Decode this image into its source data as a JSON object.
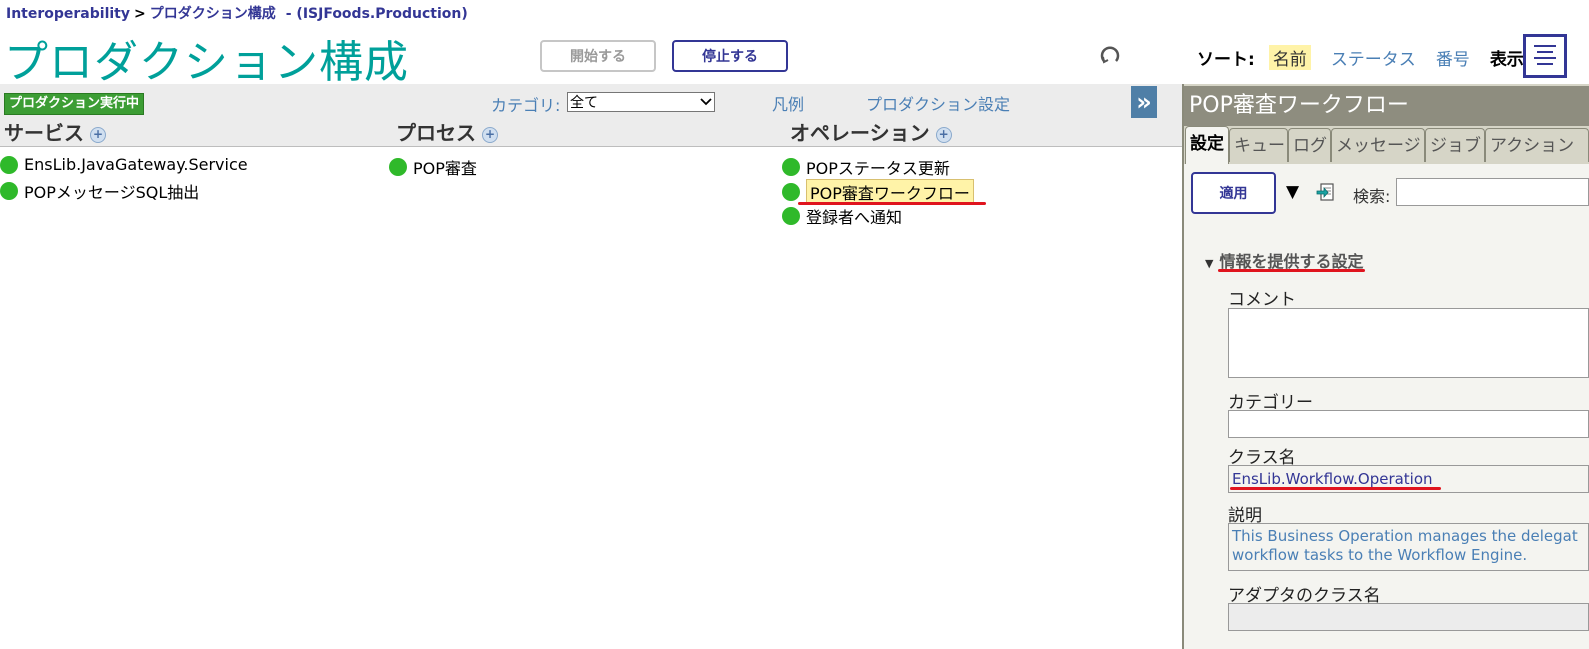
{
  "breadcrumb": {
    "root": "Interoperability",
    "separator": ">",
    "page": "プロダクション構成",
    "namespace": "- (ISJFoods.Production)"
  },
  "header": {
    "title": "プロダクション構成",
    "start_label": "開始する",
    "stop_label": "停止する",
    "sort_label": "ソート:",
    "sort_options": [
      "名前",
      "ステータス",
      "番号"
    ],
    "sort_selected": "名前",
    "view_label": "表示:"
  },
  "toolbar": {
    "status_badge": "プロダクション実行中",
    "category_label": "カテゴリ:",
    "category_value": "全て",
    "legend_link": "凡例",
    "settings_link": "プロダクション設定",
    "collapse_glyph": "»"
  },
  "columns": {
    "services": {
      "title": "サービス",
      "items": [
        "EnsLib.JavaGateway.Service",
        "POPメッセージSQL抽出"
      ]
    },
    "processes": {
      "title": "プロセス",
      "items": [
        "POP審査"
      ]
    },
    "operations": {
      "title": "オペレーション",
      "items": [
        "POPステータス更新",
        "POP審査ワークフロー",
        "登録者へ通知"
      ],
      "selected": "POP審査ワークフロー"
    }
  },
  "status_color": "#2fb92a",
  "panel": {
    "title": "POP審査ワークフロー",
    "tabs": [
      "設定",
      "キュー",
      "ログ",
      "メッセージ",
      "ジョブ",
      "アクション"
    ],
    "active_tab": "設定",
    "apply_label": "適用",
    "search_label": "検索:",
    "section_title": "情報を提供する設定",
    "fields": {
      "comment_label": "コメント",
      "category_label": "カテゴリー",
      "classname_label": "クラス名",
      "classname_value": "EnsLib.Workflow.Operation",
      "description_label": "説明",
      "description_line1": "This Business Operation manages the delegat",
      "description_line2": "workflow tasks to the Workflow Engine.",
      "adapter_label": "アダプタのクラス名"
    }
  }
}
